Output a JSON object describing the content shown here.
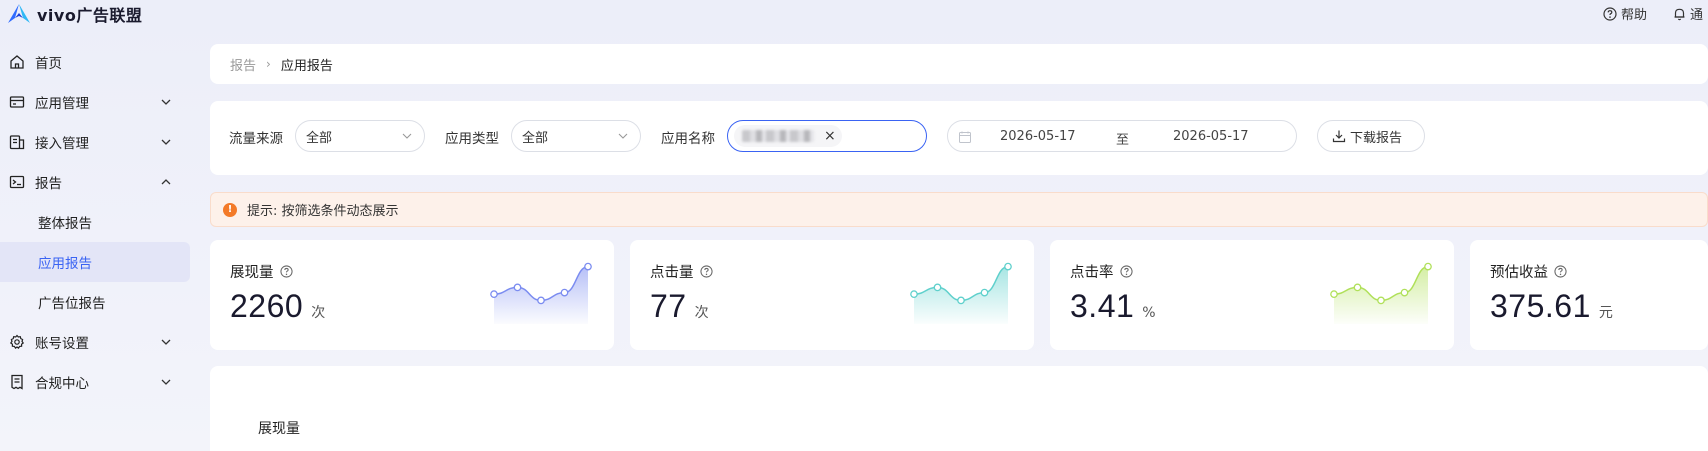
{
  "app": {
    "logo_text": "vivo广告联盟"
  },
  "header": {
    "help_label": "帮助",
    "notice_label": "通"
  },
  "sidebar": {
    "items": [
      {
        "label": "首页",
        "icon": "home-icon"
      },
      {
        "label": "应用管理",
        "icon": "app-card-icon"
      },
      {
        "label": "接入管理",
        "icon": "access-icon"
      },
      {
        "label": "报告",
        "icon": "report-icon"
      },
      {
        "label": "整体报告"
      },
      {
        "label": "应用报告",
        "active": true
      },
      {
        "label": "广告位报告"
      },
      {
        "label": "账号设置",
        "icon": "gear-icon"
      },
      {
        "label": "合规中心",
        "icon": "compliance-icon"
      }
    ]
  },
  "breadcrumb": {
    "parent": "报告",
    "current": "应用报告"
  },
  "filters": {
    "traffic_label": "流量来源",
    "traffic_value": "全部",
    "apptype_label": "应用类型",
    "apptype_value": "全部",
    "appname_label": "应用名称",
    "date_start": "2026-05-17",
    "date_sep": "至",
    "date_end": "2026-05-17",
    "download_label": "下载报告"
  },
  "notice": {
    "text": "提示: 按筛选条件动态展示"
  },
  "stats": [
    {
      "title": "展现量",
      "value": "2260",
      "unit": "次",
      "color": "#7b8cf0",
      "trend": [
        0.42,
        0.55,
        0.3,
        0.45,
        0.95
      ]
    },
    {
      "title": "点击量",
      "value": "77",
      "unit": "次",
      "color": "#5fd0cc",
      "trend": [
        0.42,
        0.55,
        0.3,
        0.45,
        0.95
      ]
    },
    {
      "title": "点击率",
      "value": "3.41",
      "unit": "%",
      "color": "#b0e05a",
      "trend": [
        0.42,
        0.55,
        0.3,
        0.45,
        0.95
      ]
    },
    {
      "title": "预估收益",
      "value": "375.61",
      "unit": "元",
      "color": "#7b8cf0",
      "trend": []
    }
  ],
  "chart_section": {
    "title": "展现量"
  }
}
